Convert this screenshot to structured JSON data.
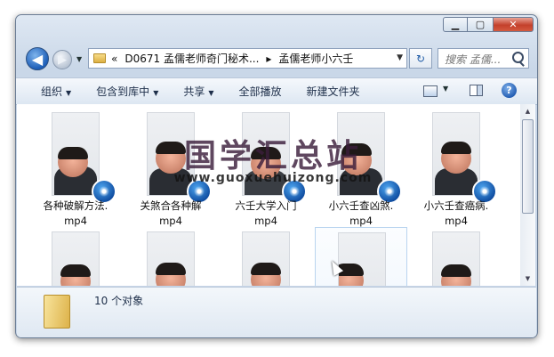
{
  "window": {
    "min_glyph": "▁",
    "max_glyph": "▢",
    "close_glyph": "✕"
  },
  "nav": {
    "back_glyph": "◀",
    "fwd_glyph": "▶",
    "breadcrumb_prefix": "«",
    "breadcrumb": [
      "D0671 孟儒老师奇门秘术...",
      "孟儒老师小六壬"
    ],
    "separator": "▸",
    "refresh_glyph": "↻",
    "search_placeholder": "搜索 孟儒..."
  },
  "toolbar": {
    "organize": "组织",
    "include_library": "包含到库中",
    "share": "共享",
    "play_all": "全部播放",
    "new_folder": "新建文件夹",
    "help": "?"
  },
  "files": [
    {
      "name": [
        "各种破解方法.",
        "mp4"
      ]
    },
    {
      "name": [
        "关煞合各种解",
        "mp4"
      ]
    },
    {
      "name": [
        "六壬大学入门",
        "mp4"
      ]
    },
    {
      "name": [
        "小六壬查凶煞.",
        "mp4"
      ]
    },
    {
      "name": [
        "小六壬查癌病.",
        "mp4"
      ]
    },
    {
      "name": [
        "",
        ""
      ]
    },
    {
      "name": [
        "",
        ""
      ]
    },
    {
      "name": [
        "",
        ""
      ]
    },
    {
      "name": [
        "",
        ""
      ]
    },
    {
      "name": [
        "",
        ""
      ]
    }
  ],
  "watermark": {
    "main": "国学汇总站",
    "url": "www.guoxuehuizong.com"
  },
  "details": {
    "count": "10 个对象"
  },
  "colors": {
    "accent": "#1f5ab0",
    "close": "#c4402c",
    "folder": "#ddb24a"
  }
}
